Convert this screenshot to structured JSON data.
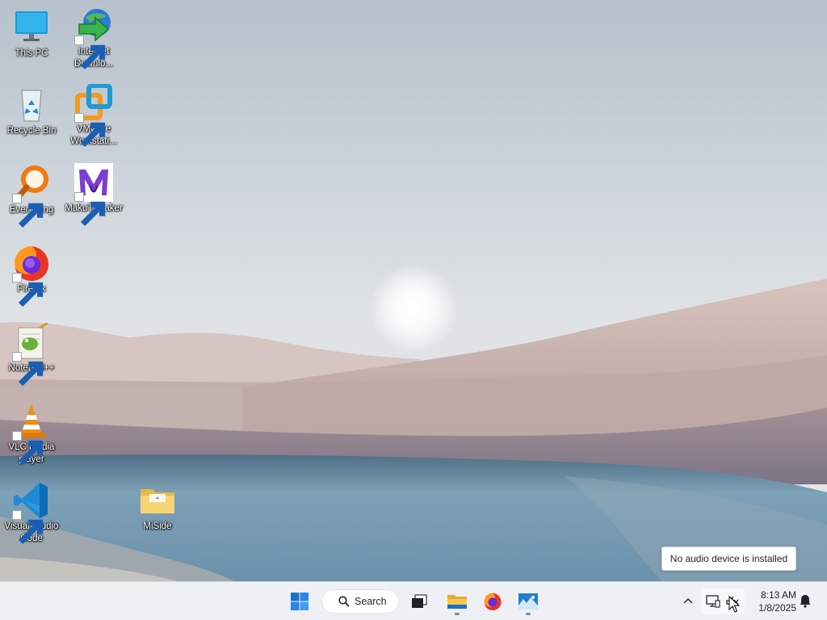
{
  "desktop": {
    "icons": [
      {
        "id": "this-pc",
        "label": "This PC"
      },
      {
        "id": "internet-download-manager",
        "label": "Internet Downlo..."
      },
      {
        "id": "recycle-bin",
        "label": "Recycle Bin"
      },
      {
        "id": "vmware-workstation",
        "label": "VMware Workstati..."
      },
      {
        "id": "everything",
        "label": "Everything"
      },
      {
        "id": "makutweaker",
        "label": "MakuTweaker"
      },
      {
        "id": "firefox",
        "label": "Firefox"
      },
      {
        "id": "notepad-plus-plus",
        "label": "Notepad++"
      },
      {
        "id": "vlc-media-player",
        "label": "VLC media player"
      },
      {
        "id": "visual-studio-code",
        "label": "Visual Studio Code"
      },
      {
        "id": "miside",
        "label": "MiSide"
      }
    ]
  },
  "notification": {
    "text": "No audio device is installed"
  },
  "taskbar": {
    "search_label": "Search",
    "pinned": [
      {
        "name": "start-button",
        "icon": "windows-logo-icon"
      },
      {
        "name": "search-box",
        "icon": "search-icon"
      },
      {
        "name": "task-view-button",
        "icon": "task-view-icon"
      },
      {
        "name": "file-explorer-button",
        "icon": "folder-icon",
        "running": true
      },
      {
        "name": "firefox-taskbar-button",
        "icon": "firefox-icon",
        "running": false
      },
      {
        "name": "app-taskbar-button",
        "icon": "landscape-app-icon",
        "running": true
      }
    ],
    "tray": {
      "time": "8:13 AM",
      "date": "1/8/2025",
      "icons": [
        "chevron-up-icon",
        "network-icon",
        "speaker-muted-icon",
        "notification-bell-icon"
      ]
    }
  },
  "colors": {
    "taskbar_bg": "#eef0f3",
    "win_blue": "#1f6fd1",
    "sky_top": "#b7c2cc",
    "sand": "#cbb7b3",
    "lake": "#6a8fa6"
  }
}
